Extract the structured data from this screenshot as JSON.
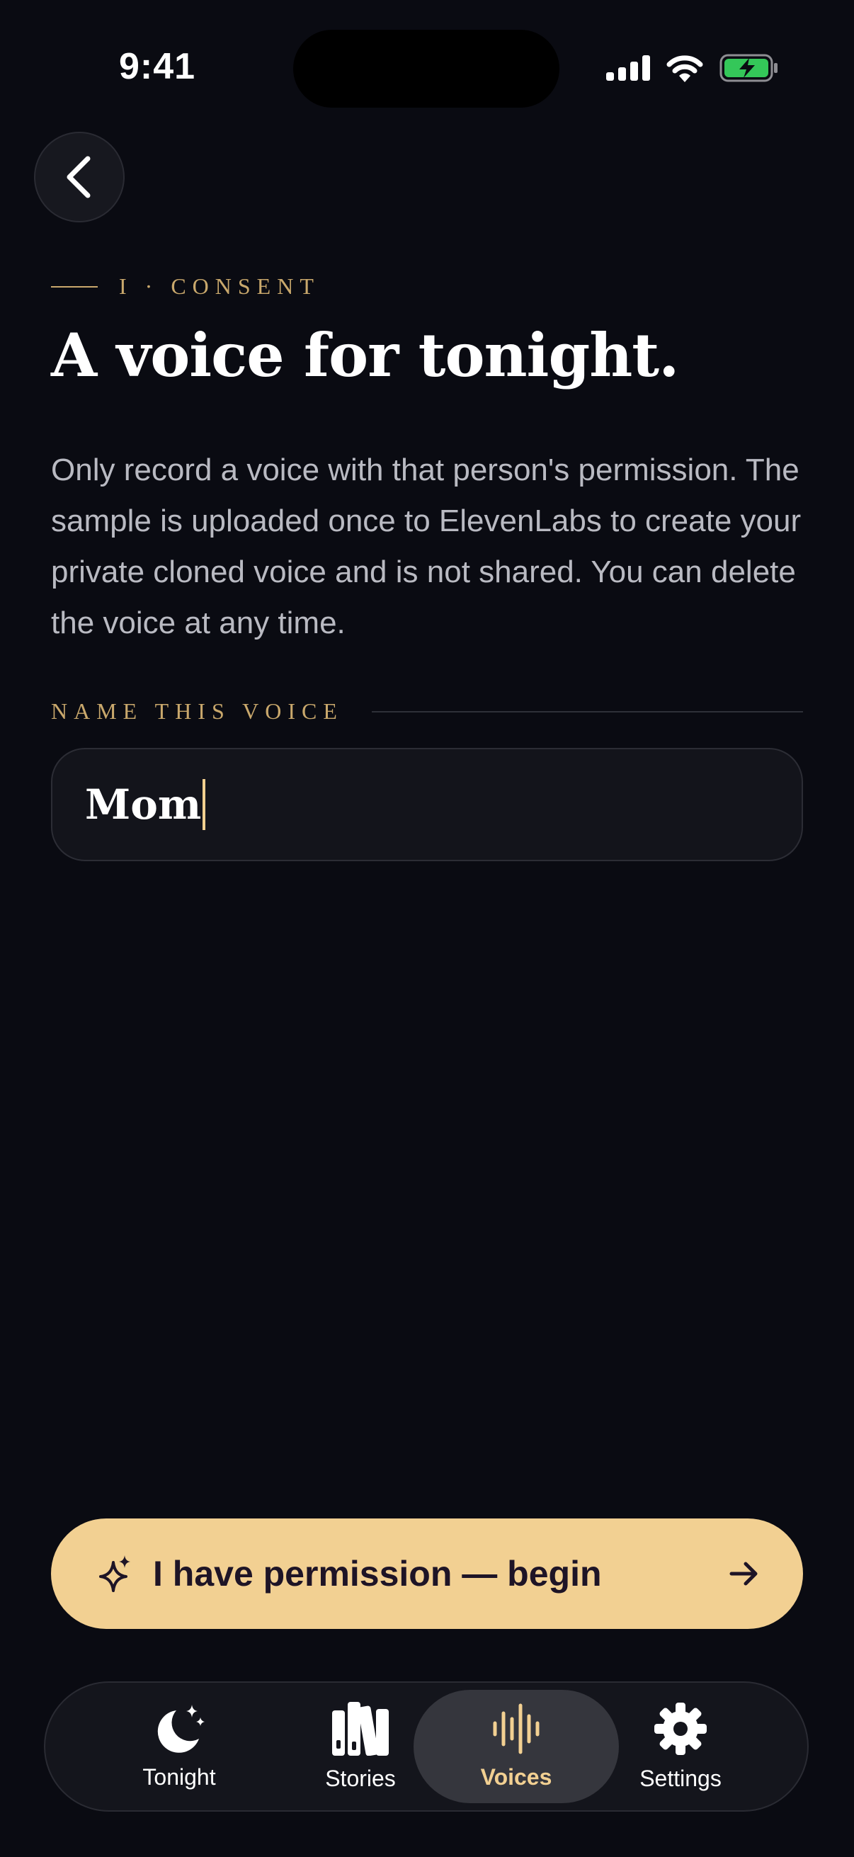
{
  "status_bar": {
    "time": "9:41"
  },
  "header": {
    "step_label": "I · CONSENT",
    "title": "A voice for tonight."
  },
  "body": {
    "description": "Only record a voice with that person's permission. The sample is uploaded once to ElevenLabs to create your private cloned voice and is not shared. You can delete the voice at any time."
  },
  "form": {
    "name_label": "NAME THIS VOICE",
    "name_value": "Mom"
  },
  "cta": {
    "label": "I have permission — begin"
  },
  "tabbar": {
    "tabs": [
      {
        "label": "Tonight",
        "icon": "moon-stars-icon"
      },
      {
        "label": "Stories",
        "icon": "books-icon"
      },
      {
        "label": "Voices",
        "icon": "waveform-icon",
        "active": true
      },
      {
        "label": "Settings",
        "icon": "gear-icon"
      }
    ]
  },
  "colors": {
    "background": "#0a0b12",
    "accent": "#f2d092",
    "gold_label": "#c9a86c",
    "battery": "#34c759"
  }
}
